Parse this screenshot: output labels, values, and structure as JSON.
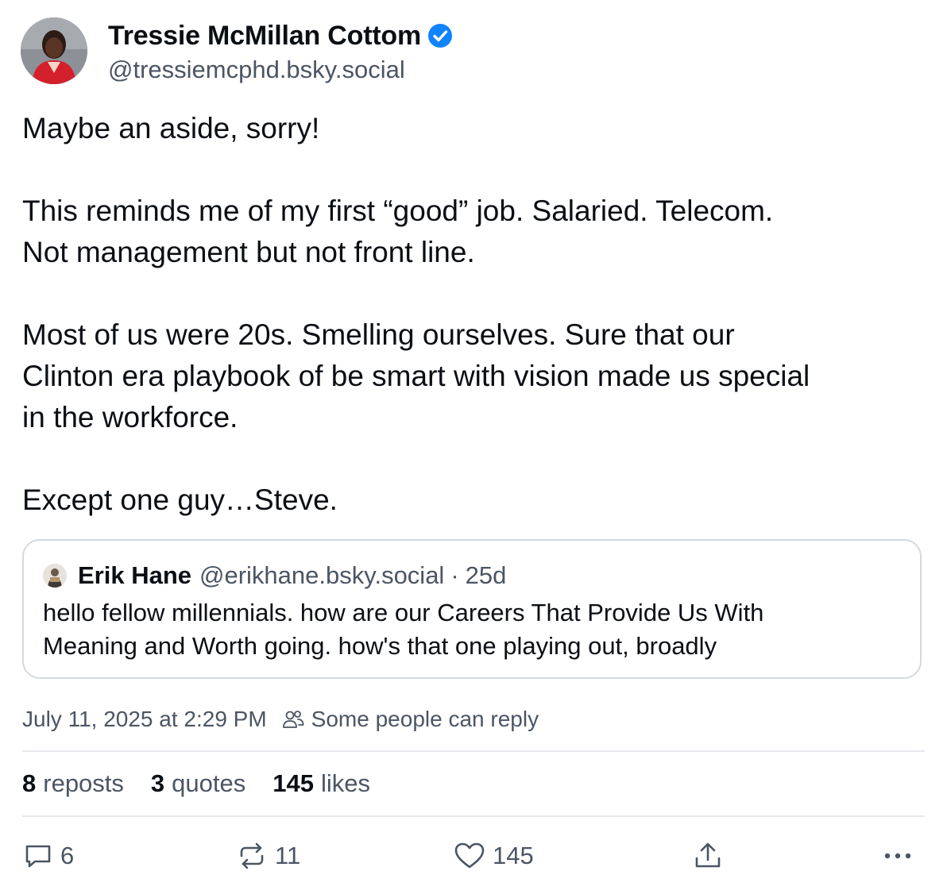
{
  "author": {
    "name": "Tressie McMillan Cottom",
    "handle": "@tressiemcphd.bsky.social"
  },
  "post": {
    "paragraphs": [
      [
        "Maybe an aside, sorry!"
      ],
      [
        "This reminds me of my first “good” job. Salaried. Telecom.",
        "Not management but not front line."
      ],
      [
        "Most of us were 20s. Smelling ourselves. Sure that our",
        "Clinton era playbook of be smart with vision made us special",
        "in the workforce."
      ],
      [
        "Except one guy…Steve."
      ]
    ]
  },
  "quote": {
    "name": "Erik Hane",
    "handle": "@erikhane.bsky.social",
    "separator": "·",
    "time": "25d",
    "lines": [
      "hello fellow millennials. how are our Careers That Provide Us With",
      "Meaning and Worth going. how's that one playing out, broadly"
    ]
  },
  "meta": {
    "timestamp": "July 11, 2025 at 2:29 PM",
    "reply_setting": "Some people can reply"
  },
  "stats": {
    "reposts_count": "8",
    "reposts_label": "reposts",
    "quotes_count": "3",
    "quotes_label": "quotes",
    "likes_count": "145",
    "likes_label": "likes"
  },
  "actions": {
    "reply_count": "6",
    "repost_count": "11",
    "like_count": "145"
  },
  "icons": {
    "verified": "verified-check-icon",
    "reply_setting": "people-icon",
    "reply": "speech-bubble-icon",
    "repost": "repost-arrows-icon",
    "like": "heart-icon",
    "share": "share-upload-icon",
    "more": "ellipsis-icon"
  },
  "colors": {
    "verified": "#1083fe",
    "text_primary": "#0b0f14",
    "text_secondary": "#4b5563",
    "border": "#d4d9df"
  }
}
